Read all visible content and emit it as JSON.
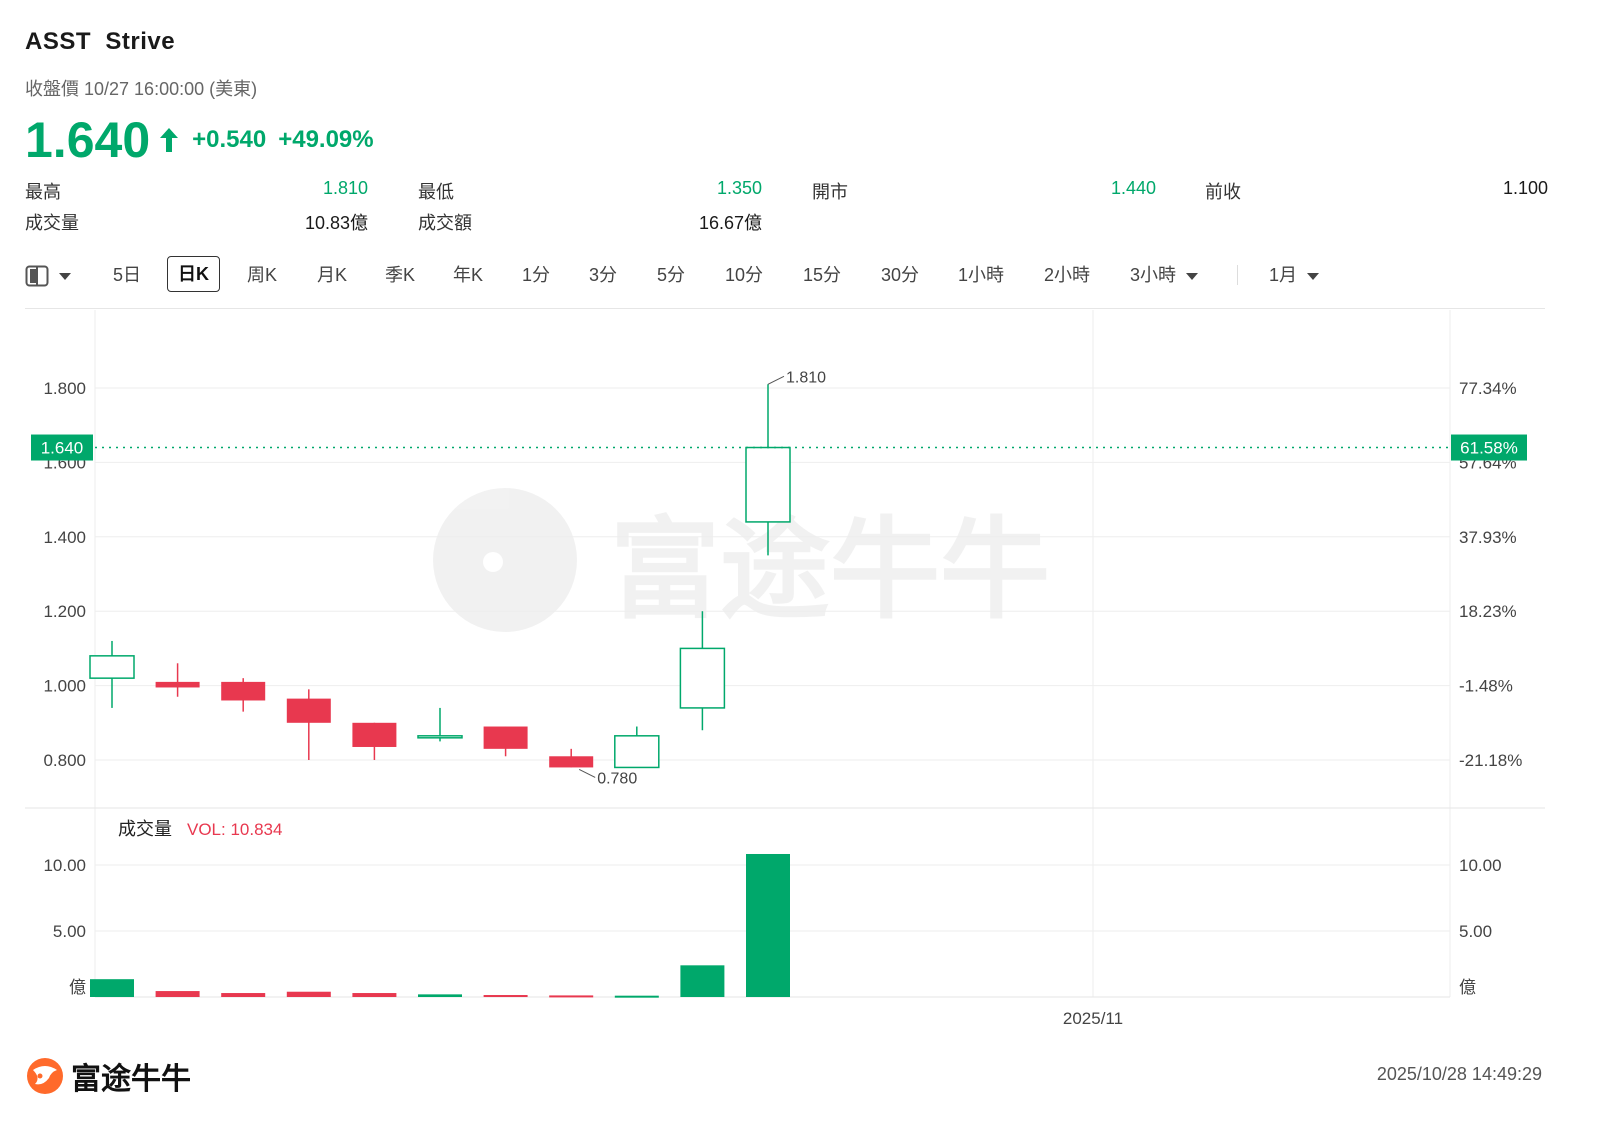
{
  "header": {
    "symbol": "ASST",
    "name": "Strive",
    "subtitle": "收盤價 10/27 16:00:00 (美東)",
    "price": "1.640",
    "change": "+0.540",
    "change_pct": "+49.09%"
  },
  "stats": [
    {
      "label": "最高",
      "value": "1.810",
      "green": true
    },
    {
      "label": "最低",
      "value": "1.350",
      "green": true
    },
    {
      "label": "開市",
      "value": "1.440",
      "green": true
    },
    {
      "label": "前收",
      "value": "1.100",
      "green": false
    },
    {
      "label": "成交量",
      "value": "10.83億",
      "green": false
    },
    {
      "label": "成交額",
      "value": "16.67億",
      "green": false
    }
  ],
  "toolbar": {
    "items": [
      "5日",
      "日K",
      "周K",
      "月K",
      "季K",
      "年K",
      "1分",
      "3分",
      "5分",
      "10分",
      "15分",
      "30分",
      "1小時",
      "2小時",
      "3小時",
      "1月"
    ],
    "active": "日K"
  },
  "colors": {
    "up": "#00a86b",
    "down": "#e8384f",
    "grid": "#eeeeee"
  },
  "chart_data": {
    "type": "candlestick",
    "y_ticks_left": [
      "1.800",
      "1.600",
      "1.400",
      "1.200",
      "1.000",
      "0.800"
    ],
    "y_ticks_right": [
      "77.34%",
      "57.64%",
      "37.93%",
      "18.23%",
      "-1.48%",
      "-21.18%"
    ],
    "ylim": [
      0.6,
      2.0
    ],
    "current_price_label": "1.640",
    "current_pct_label": "61.58%",
    "current_price": 1.64,
    "high_label": "1.810",
    "low_label": "0.780",
    "x_label": "2025/11",
    "candles": [
      {
        "open": 1.08,
        "close": 1.02,
        "high": 1.12,
        "low": 0.94,
        "dir": "up"
      },
      {
        "open": 1.01,
        "close": 0.995,
        "high": 1.06,
        "low": 0.97,
        "dir": "down"
      },
      {
        "open": 1.01,
        "close": 0.96,
        "high": 1.02,
        "low": 0.93,
        "dir": "down"
      },
      {
        "open": 0.965,
        "close": 0.9,
        "high": 0.99,
        "low": 0.8,
        "dir": "down"
      },
      {
        "open": 0.9,
        "close": 0.835,
        "high": 0.9,
        "low": 0.8,
        "dir": "down"
      },
      {
        "open": 0.865,
        "close": 0.86,
        "high": 0.94,
        "low": 0.85,
        "dir": "up"
      },
      {
        "open": 0.89,
        "close": 0.83,
        "high": 0.89,
        "low": 0.81,
        "dir": "down"
      },
      {
        "open": 0.81,
        "close": 0.78,
        "high": 0.83,
        "low": 0.78,
        "dir": "down"
      },
      {
        "open": 0.78,
        "close": 0.865,
        "high": 0.89,
        "low": 0.78,
        "dir": "up"
      },
      {
        "open": 0.94,
        "close": 1.1,
        "high": 1.2,
        "low": 0.88,
        "dir": "up"
      },
      {
        "open": 1.44,
        "close": 1.64,
        "high": 1.81,
        "low": 1.35,
        "dir": "up"
      }
    ],
    "volume": {
      "title": "成交量",
      "vol_label": "VOL: 10.834",
      "y_ticks": [
        "10.00",
        "5.00"
      ],
      "unit": "億",
      "ylim": [
        0,
        11
      ],
      "values": [
        1.35,
        0.45,
        0.3,
        0.4,
        0.3,
        0.2,
        0.15,
        0.12,
        0.1,
        2.4,
        10.834
      ],
      "dirs": [
        "up",
        "down",
        "down",
        "down",
        "down",
        "up",
        "down",
        "down",
        "up",
        "up",
        "up"
      ]
    }
  },
  "footer": {
    "brand": "富途牛牛",
    "timestamp": "2025/10/28 14:49:29"
  }
}
